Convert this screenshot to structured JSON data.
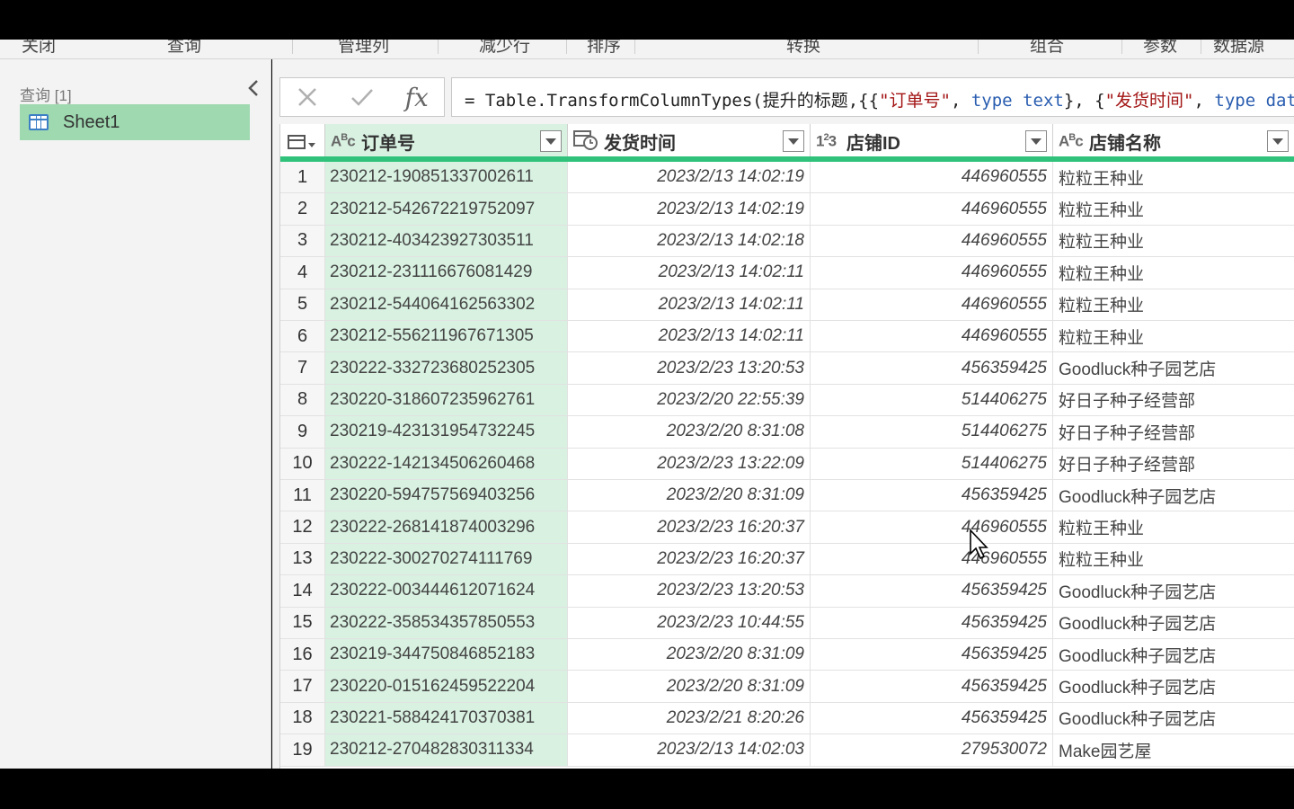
{
  "ribbon": {
    "groups": [
      "关闭",
      "查询",
      "管理列",
      "减少行",
      "排序",
      "转换",
      "组合",
      "参数",
      "数据源"
    ]
  },
  "query_pane": {
    "title": "查询 [1]",
    "items": [
      {
        "label": "Sheet1",
        "selected": true
      }
    ]
  },
  "formula_bar": {
    "cancel_icon": "close-icon",
    "confirm_icon": "check-icon",
    "fx_label": "fx",
    "segments": [
      {
        "text": "= Table.TransformColumnTypes(提升的标题,{{",
        "kind": "plain"
      },
      {
        "text": "\"订单号\"",
        "kind": "string"
      },
      {
        "text": ", ",
        "kind": "plain"
      },
      {
        "text": "type",
        "kind": "keyword"
      },
      {
        "text": " ",
        "kind": "plain"
      },
      {
        "text": "text",
        "kind": "keyword"
      },
      {
        "text": "}, {",
        "kind": "plain"
      },
      {
        "text": "\"发货时间\"",
        "kind": "string"
      },
      {
        "text": ", ",
        "kind": "plain"
      },
      {
        "text": "type",
        "kind": "keyword"
      },
      {
        "text": " ",
        "kind": "plain"
      },
      {
        "text": "dat",
        "kind": "keyword"
      }
    ]
  },
  "grid": {
    "columns": [
      {
        "type_icon": "ABC",
        "title": "订单号"
      },
      {
        "type_icon": "datetime",
        "title": "发货时间"
      },
      {
        "type_icon": "123",
        "title": "店铺ID"
      },
      {
        "type_icon": "ABC",
        "title": "店铺名称"
      }
    ],
    "rows": [
      [
        "1",
        "230212-190851337002611",
        "2023/2/13 14:02:19",
        "446960555",
        "粒粒王种业"
      ],
      [
        "2",
        "230212-542672219752097",
        "2023/2/13 14:02:19",
        "446960555",
        "粒粒王种业"
      ],
      [
        "3",
        "230212-403423927303511",
        "2023/2/13 14:02:18",
        "446960555",
        "粒粒王种业"
      ],
      [
        "4",
        "230212-231116676081429",
        "2023/2/13 14:02:11",
        "446960555",
        "粒粒王种业"
      ],
      [
        "5",
        "230212-544064162563302",
        "2023/2/13 14:02:11",
        "446960555",
        "粒粒王种业"
      ],
      [
        "6",
        "230212-556211967671305",
        "2023/2/13 14:02:11",
        "446960555",
        "粒粒王种业"
      ],
      [
        "7",
        "230222-332723680252305",
        "2023/2/23 13:20:53",
        "456359425",
        "Goodluck种子园艺店"
      ],
      [
        "8",
        "230220-318607235962761",
        "2023/2/20 22:55:39",
        "514406275",
        "好日子种子经营部"
      ],
      [
        "9",
        "230219-423131954732245",
        "2023/2/20 8:31:08",
        "514406275",
        "好日子种子经营部"
      ],
      [
        "10",
        "230222-142134506260468",
        "2023/2/23 13:22:09",
        "514406275",
        "好日子种子经营部"
      ],
      [
        "11",
        "230220-594757569403256",
        "2023/2/20 8:31:09",
        "456359425",
        "Goodluck种子园艺店"
      ],
      [
        "12",
        "230222-268141874003296",
        "2023/2/23 16:20:37",
        "446960555",
        "粒粒王种业"
      ],
      [
        "13",
        "230222-300270274111769",
        "2023/2/23 16:20:37",
        "446960555",
        "粒粒王种业"
      ],
      [
        "14",
        "230222-003444612071624",
        "2023/2/23 13:20:53",
        "456359425",
        "Goodluck种子园艺店"
      ],
      [
        "15",
        "230222-358534357850553",
        "2023/2/23 10:44:55",
        "456359425",
        "Goodluck种子园艺店"
      ],
      [
        "16",
        "230219-344750846852183",
        "2023/2/20 8:31:09",
        "456359425",
        "Goodluck种子园艺店"
      ],
      [
        "17",
        "230220-015162459522204",
        "2023/2/20 8:31:09",
        "456359425",
        "Goodluck种子园艺店"
      ],
      [
        "18",
        "230221-588424170370381",
        "2023/2/21 8:20:26",
        "456359425",
        "Goodluck种子园艺店"
      ],
      [
        "19",
        "230212-270482830311334",
        "2023/2/13 14:02:03",
        "279530072",
        "Make园艺屋"
      ]
    ]
  },
  "colors": {
    "selected_query": "#9ed9b0",
    "selected_column": "#d8f1e1",
    "header_underline": "#30c27a"
  }
}
